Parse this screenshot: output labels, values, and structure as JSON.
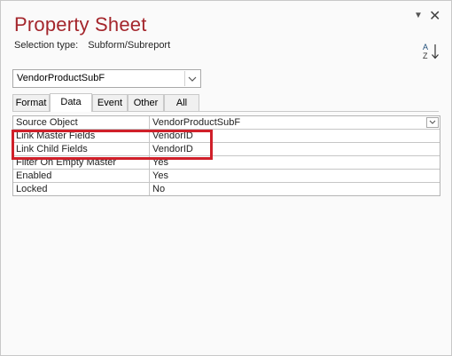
{
  "panel": {
    "title": "Property Sheet",
    "selection_label": "Selection type:",
    "selection_value": "Subform/Subreport"
  },
  "object_selector": {
    "value": "VendorProductSubF"
  },
  "tabs": [
    {
      "label": "Format",
      "active": false
    },
    {
      "label": "Data",
      "active": true
    },
    {
      "label": "Event",
      "active": false
    },
    {
      "label": "Other",
      "active": false
    },
    {
      "label": "All",
      "active": false
    }
  ],
  "properties": [
    {
      "name": "Source Object",
      "value": "VendorProductSubF",
      "dropdown": true
    },
    {
      "name": "Link Master Fields",
      "value": "VendorID"
    },
    {
      "name": "Link Child Fields",
      "value": "VendorID"
    },
    {
      "name": "Filter On Empty Master",
      "value": "Yes"
    },
    {
      "name": "Enabled",
      "value": "Yes"
    },
    {
      "name": "Locked",
      "value": "No"
    }
  ],
  "colors": {
    "title": "#a4262c",
    "highlight_box": "#d0202a"
  },
  "icons": {
    "menu": "chevron-down-icon",
    "close": "close-icon",
    "sort": "sort-az-icon"
  }
}
